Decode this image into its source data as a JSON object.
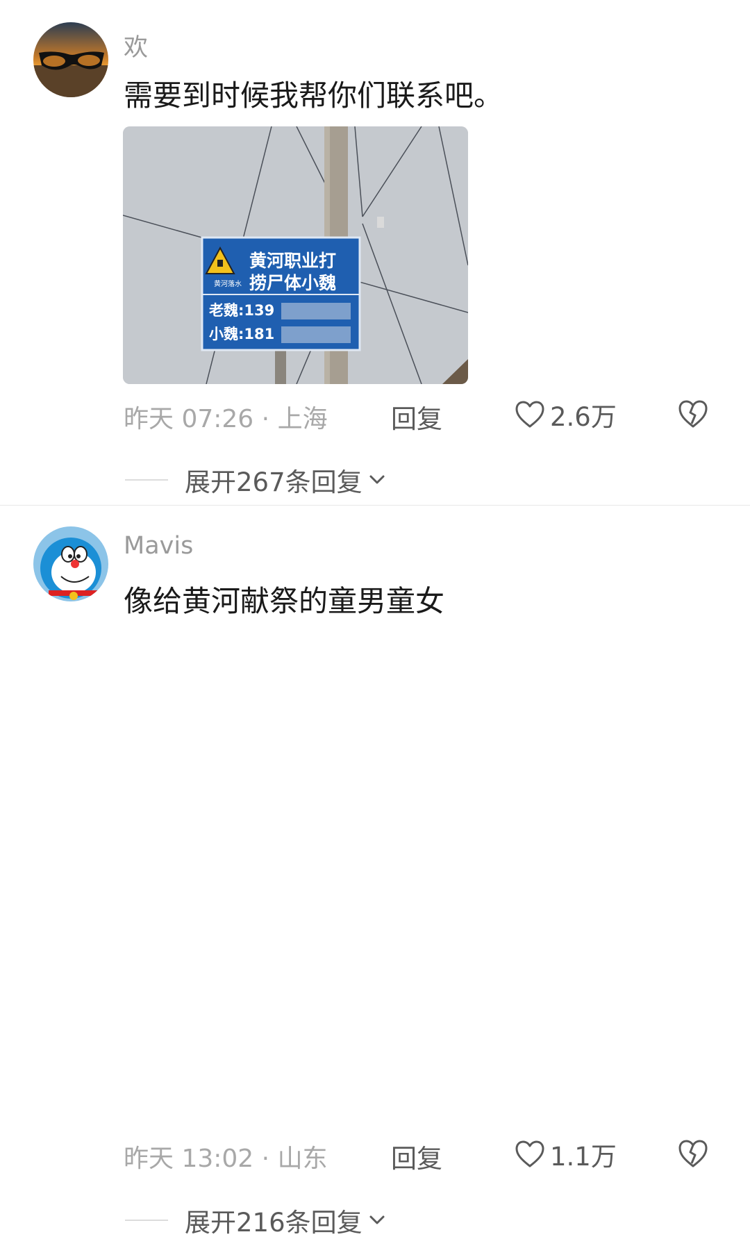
{
  "comments": [
    {
      "username": "欢",
      "text": "需要到时候我帮你们联系吧。",
      "photo": {
        "sign_title": "黄河职业打捞尸体小魏",
        "sign_line1": "黄河职业打",
        "sign_line2": "捞尸体小魏",
        "sign_tag": "黄河落水",
        "sign_phone1": "老魏:139",
        "sign_phone2": "小魏:181"
      },
      "time": "昨天 07:26",
      "location": "上海",
      "meta_separator": "·",
      "reply_label": "回复",
      "like_count": "2.6万",
      "expand_label": "展开267条回复"
    },
    {
      "username": "Mavis",
      "text": "像给黄河献祭的童男童女",
      "time": "昨天 13:02",
      "location": "山东",
      "meta_separator": "·",
      "reply_label": "回复",
      "like_count": "1.1万",
      "expand_label": "展开216条回复"
    }
  ],
  "icons": {
    "like": "heart-outline-icon",
    "dislike": "broken-heart-icon",
    "expand": "chevron-down-icon"
  },
  "colors": {
    "username": "#9a9a9a",
    "meta": "#a8a8a8",
    "action": "#5a5a5a",
    "sign_blue": "#1f5fb0"
  }
}
